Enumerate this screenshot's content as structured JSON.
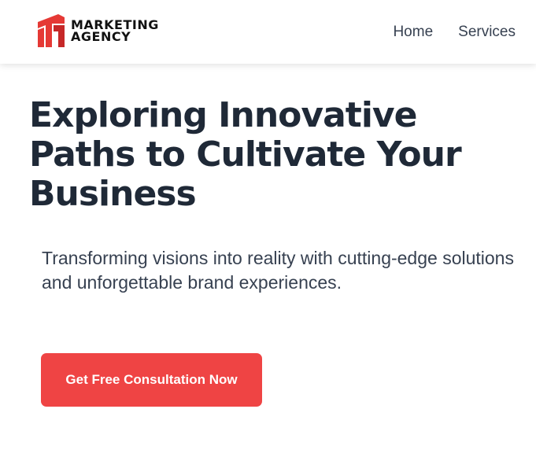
{
  "brand": {
    "line1": "MARKETING",
    "line2": "AGENCY",
    "logo_icon": "agency-logo-icon",
    "logo_color": "#e53935"
  },
  "nav": {
    "items": [
      {
        "label": "Home"
      },
      {
        "label": "Services"
      }
    ]
  },
  "hero": {
    "title": "Exploring Innovative Paths to Cultivate Your Business",
    "subtitle": "Transforming visions into reality with cutting-edge solutions and unforgettable brand experiences.",
    "cta_label": "Get Free Consultation Now",
    "cta_color": "#ef4444"
  }
}
